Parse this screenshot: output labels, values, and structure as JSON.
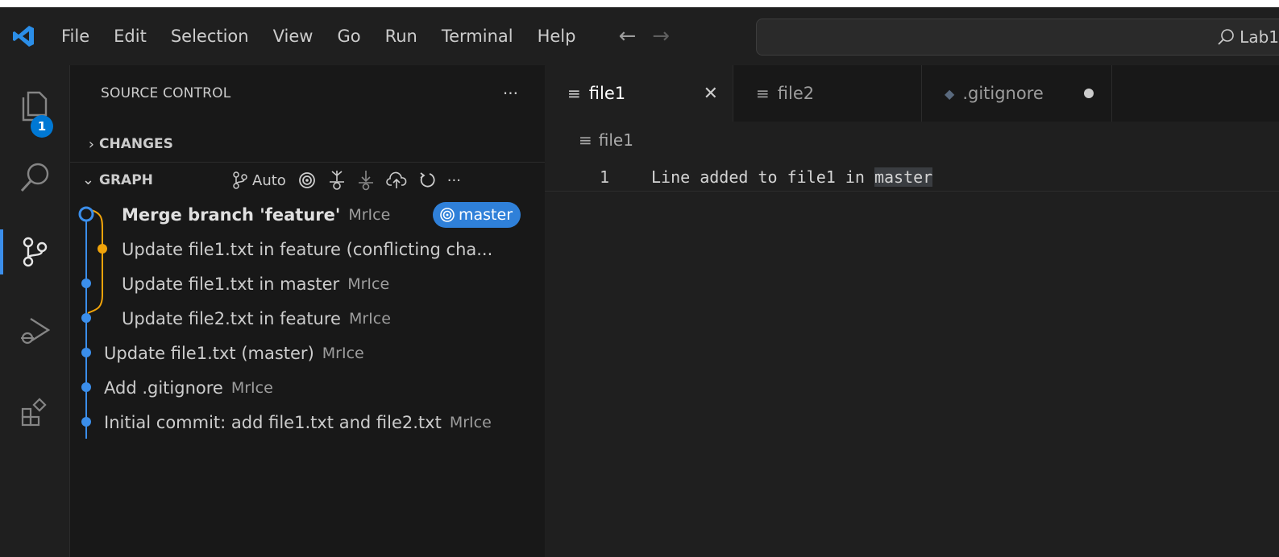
{
  "window": {
    "menu": [
      "File",
      "Edit",
      "Selection",
      "View",
      "Go",
      "Run",
      "Terminal",
      "Help"
    ],
    "search_label": "Lab1"
  },
  "activity": {
    "explorer_badge": "1"
  },
  "sidebar": {
    "title": "SOURCE CONTROL",
    "changes_title": "CHANGES",
    "graph_title": "GRAPH",
    "auto_label": "Auto",
    "commits": [
      {
        "message": "Merge branch 'feature'",
        "author": "MrIce",
        "branch": "master",
        "bold": true,
        "lane": 0,
        "color": "#3b8eea"
      },
      {
        "message": "Update file1.txt in feature (conflicting cha...",
        "author": "",
        "lane": 1,
        "color": "#f0a30a"
      },
      {
        "message": "Update file1.txt in master",
        "author": "MrIce",
        "lane": 0,
        "color": "#3b8eea"
      },
      {
        "message": "Update file2.txt in feature",
        "author": "MrIce",
        "lane": 0,
        "color": "#3b8eea"
      },
      {
        "message": "Update file1.txt (master)",
        "author": "MrIce",
        "lane": 0,
        "color": "#3b8eea"
      },
      {
        "message": "Add .gitignore",
        "author": "MrIce",
        "lane": 0,
        "color": "#3b8eea"
      },
      {
        "message": "Initial commit: add file1.txt and file2.txt",
        "author": "MrIce",
        "lane": 0,
        "color": "#3b8eea"
      }
    ]
  },
  "editor": {
    "tabs": [
      {
        "label": "file1",
        "active": true
      },
      {
        "label": "file2",
        "active": false
      },
      {
        "label": ".gitignore",
        "active": false,
        "modified": true
      }
    ],
    "breadcrumb": "file1",
    "line_number": "1",
    "line_before": "Line added to file1 in ",
    "line_highlight": "master"
  },
  "colors": {
    "accent": "#3b8eea",
    "feature_branch": "#f0a30a",
    "badge": "#2f80d9"
  }
}
